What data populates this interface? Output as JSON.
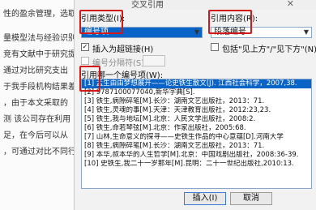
{
  "document": {
    "lines": [
      "性的盈余管理，选取",
      "量模型法与经验识别",
      "竞有文献中于研究提出",
      "通过对比研究支出",
      "于我手段机构结果差",
      "，由于本文采取的",
      "测 该公司存在利用",
      "足，在今后可以从",
      "，可通过对比不同行"
    ]
  },
  "dialog": {
    "title": "交叉引用",
    "reference_type_label": "引用类型(I):",
    "reference_type_value": "编号项",
    "insert_reference_label": "引用内容(R):",
    "insert_reference_value": "段落编号",
    "insert_hyperlink_label": "插入为超链接(H)",
    "insert_hyperlink_checked": true,
    "include_above_below_label": "包括\"见上方\"/\"见下方\"(N)",
    "include_above_below_checked": false,
    "separator_label": "编号分隔符(S)",
    "separator_checked": false,
    "list_label": "引用哪一个编号项(W):",
    "list_items": [
      "[1] 孟生由由梦想展开——论史铁生散文(J). 江西社会科学，2007,38.",
      "[2] 9787100077040,新华字典[S].",
      "[3] 铁生,病隙碎笔[M].长沙：湖南文艺出版社，2013：71.",
      "[4] 铁生,灵魂的事[M].天津：天津教育出版社，2012:23,23.",
      "[5] 铁生,我与地坛[M].北京：人民文学出版社，2008:2.",
      "[6] 铁生,命若琴弦[M].北京：作家出版社，2005:68.",
      "[7] 山林,生命意义的探寻——史铁生作品的中心意蕴[D].河南大学",
      "[8] 铁生,病隙碎笔[M].长沙：湖南文艺出版社，2013：71.",
      "[9] 本华,叔本华的人生哲学[M].北京：中国戏剧出版社，2008:36-39.",
      "[10] 史铁生,我二十一岁那年[M].昆明：二十一世纪出版社,2010:13."
    ],
    "selected_index": 0,
    "insert_button": "插入(I)",
    "cancel_button": "取消"
  }
}
